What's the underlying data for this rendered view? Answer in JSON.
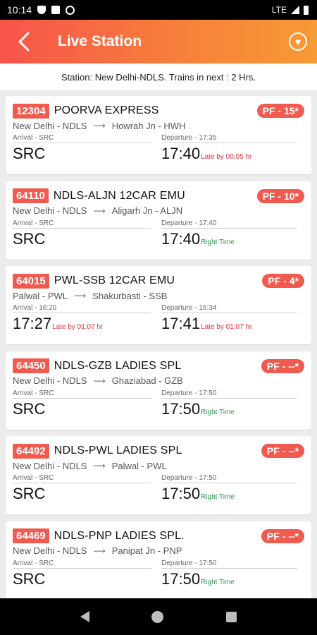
{
  "status_bar": {
    "time": "10:14",
    "network": "LTE",
    "icons": [
      "shield-icon",
      "sd-card-icon",
      "data-saver-icon",
      "signal-icon",
      "battery-icon"
    ]
  },
  "header": {
    "title": "Live Station",
    "back_icon": "chevron-left-icon",
    "fav_icon": "heart-icon"
  },
  "info": {
    "text": "Station: New Delhi-NDLS. Trains in next : 2 Hrs."
  },
  "colors": {
    "accent_red": "#f05a4f",
    "header_start": "#f7544b",
    "header_end": "#f79a34",
    "late": "#e0343a",
    "on_time": "#2e9a4e"
  },
  "trains": [
    {
      "number": "12304",
      "name": "POORVA EXPRESS",
      "platform": "PF - 15*",
      "from": "New Delhi - NDLS",
      "to": "Howrah Jn - HWH",
      "arrival_label": "Arrival - SRC",
      "arrival_value": "SRC",
      "arrival_status": "",
      "departure_label": "Departure - 17:35",
      "departure_value": "17:40",
      "departure_status": "Late by 00:05 hr"
    },
    {
      "number": "64110",
      "name": "NDLS-ALJN 12CAR EMU",
      "platform": "PF - 10*",
      "from": "New Delhi - NDLS",
      "to": "Aligarh Jn - ALJN",
      "arrival_label": "Arrival - SRC",
      "arrival_value": "SRC",
      "arrival_status": "",
      "departure_label": "Departure - 17:40",
      "departure_value": "17:40",
      "departure_status": "Right Time"
    },
    {
      "number": "64015",
      "name": "PWL-SSB 12CAR EMU",
      "platform": "PF - 4*",
      "from": "Palwal - PWL",
      "to": "Shakurbasti - SSB",
      "arrival_label": "Arrival - 16:20",
      "arrival_value": "17:27",
      "arrival_status": "Late by 01:07 hr",
      "departure_label": "Departure - 16:34",
      "departure_value": "17:41",
      "departure_status": "Late by 01:07 hr"
    },
    {
      "number": "64450",
      "name": "NDLS-GZB LADIES SPL",
      "platform": "PF - --*",
      "from": "New Delhi - NDLS",
      "to": "Ghaziabad - GZB",
      "arrival_label": "Arrival - SRC",
      "arrival_value": "SRC",
      "arrival_status": "",
      "departure_label": "Departure - 17:50",
      "departure_value": "17:50",
      "departure_status": "Right Time"
    },
    {
      "number": "64492",
      "name": "NDLS-PWL LADIES SPL",
      "platform": "PF - --*",
      "from": "New Delhi - NDLS",
      "to": "Palwal - PWL",
      "arrival_label": "Arrival - SRC",
      "arrival_value": "SRC",
      "arrival_status": "",
      "departure_label": "Departure - 17:50",
      "departure_value": "17:50",
      "departure_status": "Right Time"
    },
    {
      "number": "64469",
      "name": "NDLS-PNP LADIES SPL.",
      "platform": "PF - --*",
      "from": "New Delhi - NDLS",
      "to": "Panipat Jn - PNP",
      "arrival_label": "Arrival - SRC",
      "arrival_value": "SRC",
      "arrival_status": "",
      "departure_label": "Departure - 17:50",
      "departure_value": "17:50",
      "departure_status": "Right Time"
    }
  ],
  "nav_bar": {
    "icons": [
      "nav-back-icon",
      "nav-home-icon",
      "nav-recents-icon"
    ]
  }
}
